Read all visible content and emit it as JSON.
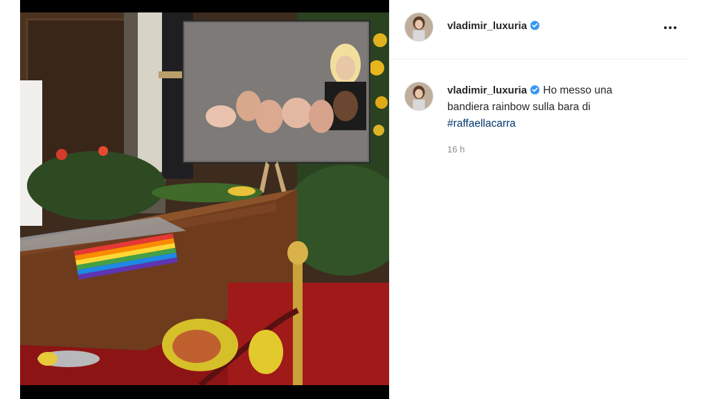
{
  "post": {
    "image_alt": "Photo of a coffin with a rainbow flag and a framed photograph"
  },
  "header": {
    "username": "vladimir_luxuria",
    "verified_icon": "verified-badge-icon",
    "more_icon": "more-options-icon"
  },
  "caption": {
    "username": "vladimir_luxuria",
    "text": "Ho messo una bandiera rainbow sulla bara di",
    "hashtag": "#raffaellacarra",
    "timestamp": "16 h"
  },
  "colors": {
    "verified_blue": "#3897f0",
    "hashtag_blue": "#00376b",
    "timestamp_gray": "#8e8e8e"
  }
}
